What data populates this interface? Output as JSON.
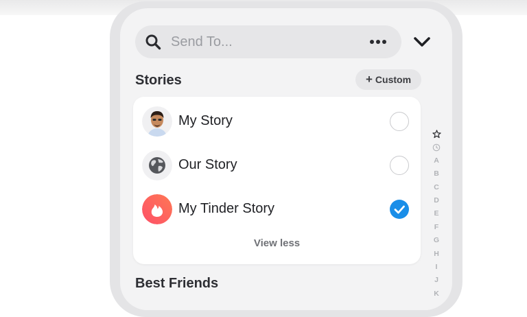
{
  "search": {
    "placeholder": "Send To..."
  },
  "stories": {
    "title": "Stories",
    "custom_label": "Custom",
    "items": [
      {
        "label": "My Story",
        "selected": false
      },
      {
        "label": "Our Story",
        "selected": false
      },
      {
        "label": "My Tinder Story",
        "selected": true
      }
    ],
    "view_less": "View less"
  },
  "best_friends": {
    "title": "Best Friends"
  },
  "index_bar": [
    "A",
    "B",
    "C",
    "D",
    "E",
    "F",
    "G",
    "H",
    "I",
    "J",
    "K"
  ],
  "colors": {
    "selected_check": "#1a8ee8",
    "tinder_gradient_start": "#fd5068",
    "tinder_gradient_end": "#ff7854"
  }
}
